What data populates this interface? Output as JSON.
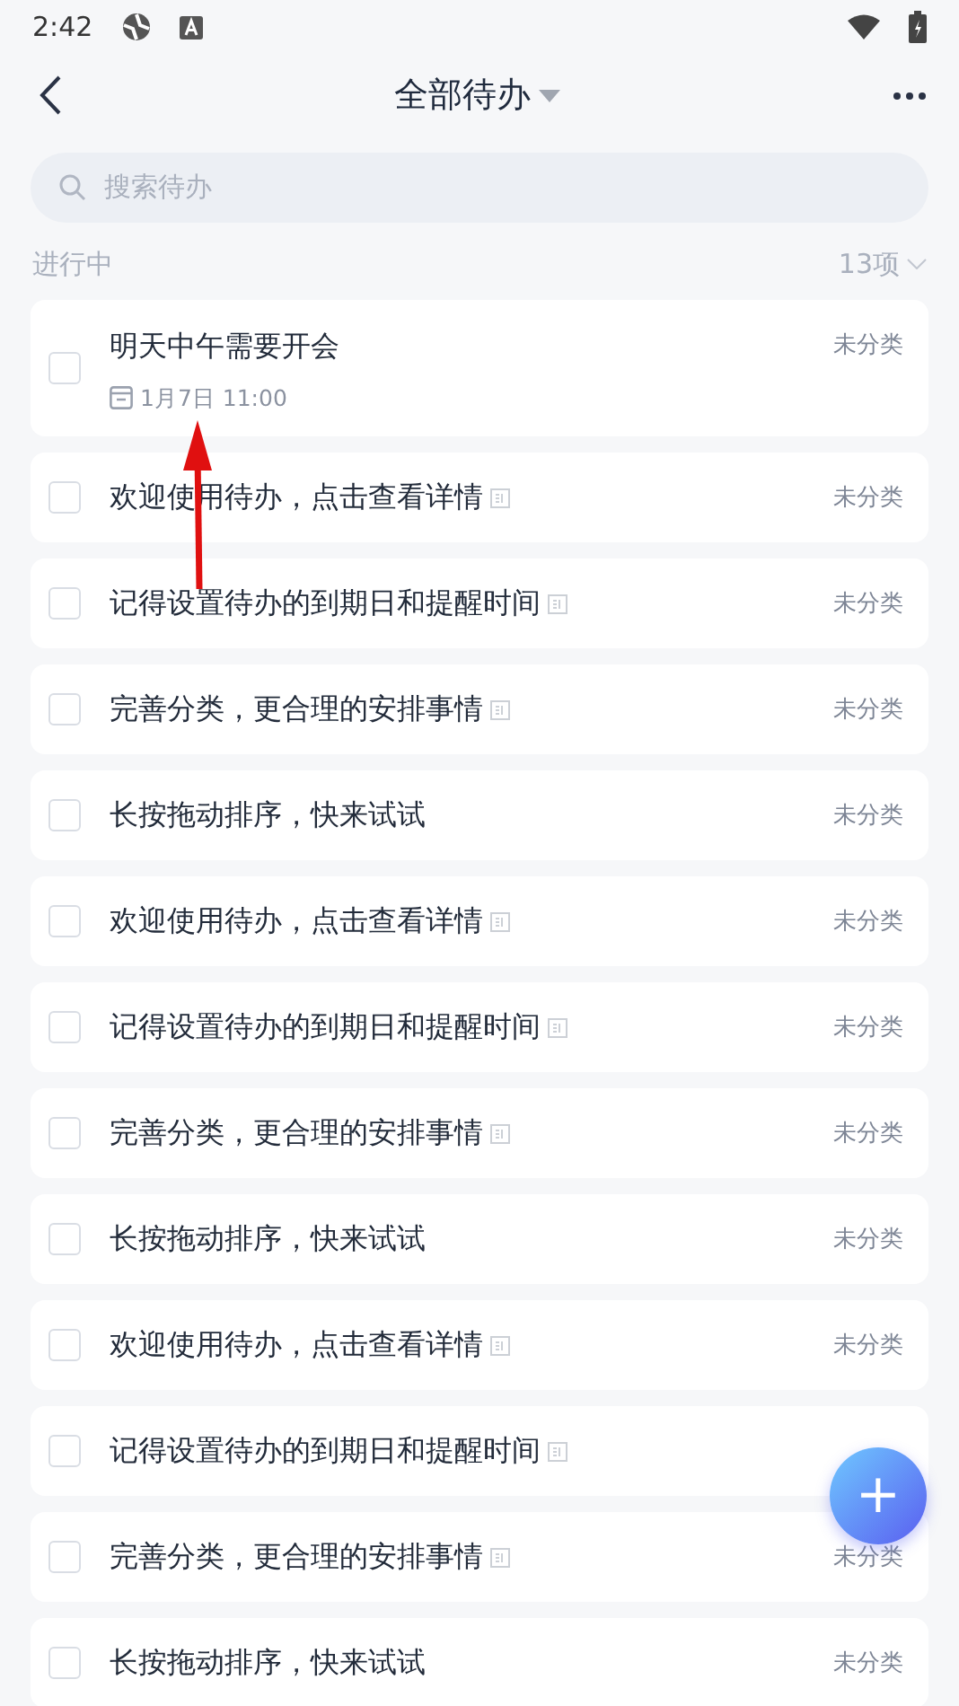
{
  "status_bar": {
    "time": "2:42"
  },
  "header": {
    "title": "全部待办"
  },
  "search": {
    "placeholder": "搜索待办"
  },
  "section": {
    "label": "进行中",
    "count": "13项"
  },
  "todos": [
    {
      "title": "明天中午需要开会",
      "date": "1月7日 11:00",
      "note": false,
      "category": "未分类",
      "checked": false
    },
    {
      "title": "欢迎使用待办，点击查看详情",
      "note": true,
      "category": "未分类",
      "checked": false
    },
    {
      "title": "记得设置待办的到期日和提醒时间",
      "note": true,
      "category": "未分类",
      "checked": false
    },
    {
      "title": "完善分类，更合理的安排事情",
      "note": true,
      "category": "未分类",
      "checked": false
    },
    {
      "title": "长按拖动排序，快来试试",
      "note": false,
      "category": "未分类",
      "checked": false
    },
    {
      "title": "欢迎使用待办，点击查看详情",
      "note": true,
      "category": "未分类",
      "checked": false
    },
    {
      "title": "记得设置待办的到期日和提醒时间",
      "note": true,
      "category": "未分类",
      "checked": false
    },
    {
      "title": "完善分类，更合理的安排事情",
      "note": true,
      "category": "未分类",
      "checked": false
    },
    {
      "title": "长按拖动排序，快来试试",
      "note": false,
      "category": "未分类",
      "checked": false
    },
    {
      "title": "欢迎使用待办，点击查看详情",
      "note": true,
      "category": "未分类",
      "checked": false
    },
    {
      "title": "记得设置待办的到期日和提醒时间",
      "note": true,
      "checked": false
    },
    {
      "title": "完善分类，更合理的安排事情",
      "note": true,
      "category": "未分类",
      "checked": false
    },
    {
      "title": "长按拖动排序，快来试试",
      "note": false,
      "category": "未分类",
      "checked": false
    }
  ],
  "fab": {
    "label": "+"
  }
}
